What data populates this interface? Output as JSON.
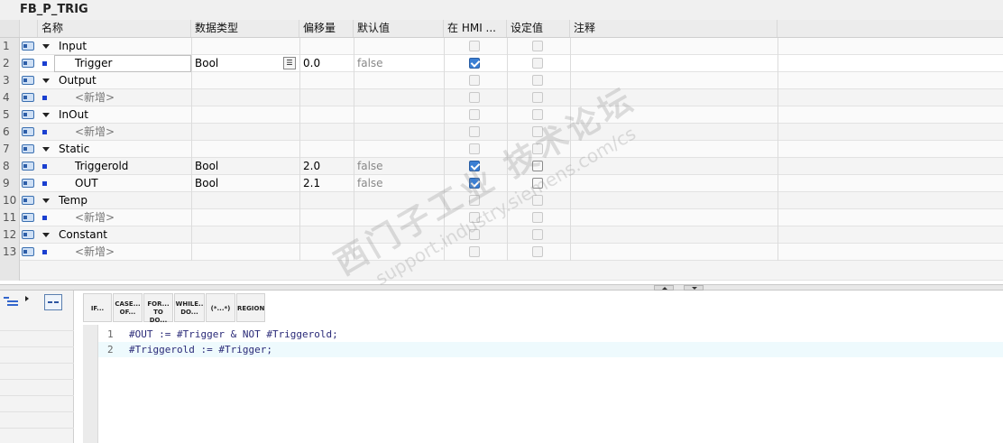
{
  "title": "FB_P_TRIG",
  "columns": {
    "name": "名称",
    "datatype": "数据类型",
    "offset": "偏移量",
    "default": "默认值",
    "hmi": "在 HMI ...",
    "setpoint": "设定值",
    "comment": "注释"
  },
  "rows": [
    {
      "num": "1",
      "kind": "section",
      "name": "Input",
      "datatype": "",
      "offset": "",
      "default": ""
    },
    {
      "num": "2",
      "kind": "var",
      "name": "Trigger",
      "datatype": "Bool",
      "offset": "0.0",
      "default": "false",
      "hmi": true
    },
    {
      "num": "3",
      "kind": "section",
      "name": "Output"
    },
    {
      "num": "4",
      "kind": "placeholder",
      "name": "<新增>"
    },
    {
      "num": "5",
      "kind": "section",
      "name": "InOut"
    },
    {
      "num": "6",
      "kind": "placeholder",
      "name": "<新增>"
    },
    {
      "num": "7",
      "kind": "section",
      "name": "Static"
    },
    {
      "num": "8",
      "kind": "var",
      "name": "Triggerold",
      "datatype": "Bool",
      "offset": "2.0",
      "default": "false",
      "hmi": true
    },
    {
      "num": "9",
      "kind": "var",
      "name": "OUT",
      "datatype": "Bool",
      "offset": "2.1",
      "default": "false",
      "hmi": true
    },
    {
      "num": "10",
      "kind": "section",
      "name": "Temp"
    },
    {
      "num": "11",
      "kind": "placeholder",
      "name": "<新增>"
    },
    {
      "num": "12",
      "kind": "section",
      "name": "Constant"
    },
    {
      "num": "13",
      "kind": "placeholder",
      "name": "<新增>"
    }
  ],
  "toolbar": {
    "if_label": "IF...",
    "case_label_1": "CASE...",
    "case_label_2": "OF...",
    "for_label_1": "FOR...",
    "for_label_2": "TO DO...",
    "while_label_1": "WHILE..",
    "while_label_2": "DO...",
    "comment_label": "(*...*)",
    "region_label": "REGION"
  },
  "code": [
    {
      "ln": "1",
      "text": "#OUT := #Trigger & NOT #Triggerold;"
    },
    {
      "ln": "2",
      "text": "#Triggerold := #Trigger;"
    }
  ],
  "watermark": {
    "main": "西门子工业 技术论坛",
    "sub": "support.industry.siemens.com/cs"
  }
}
